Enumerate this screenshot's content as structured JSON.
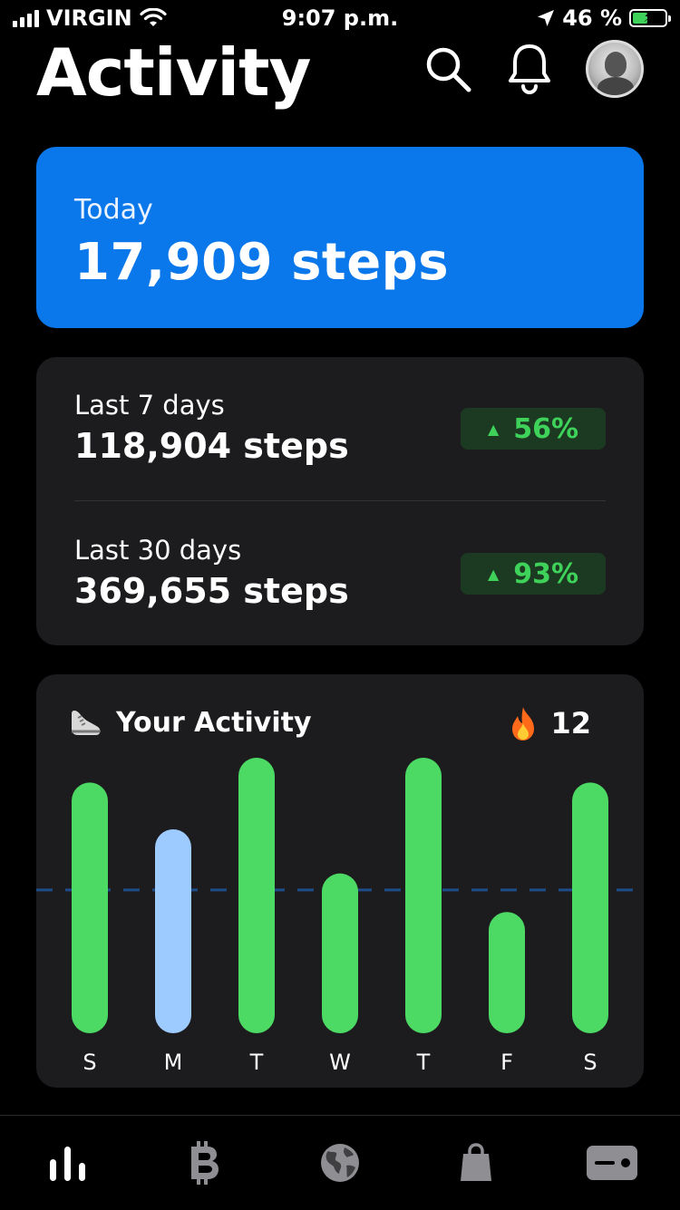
{
  "status_bar": {
    "carrier": "VIRGIN",
    "time": "9:07 p.m.",
    "battery_percent": "46 %",
    "battery_level": 0.46
  },
  "header": {
    "title": "Activity",
    "actions": [
      "search-icon",
      "bell-icon",
      "avatar"
    ]
  },
  "today": {
    "label": "Today",
    "value": "17,909 steps"
  },
  "summary": [
    {
      "label": "Last 7 days",
      "value": "118,904 steps",
      "change": "56%"
    },
    {
      "label": "Last 30 days",
      "value": "369,655 steps",
      "change": "93%"
    }
  ],
  "activity": {
    "title": "Your Activity",
    "title_icon": "sneaker-icon",
    "streak_icon": "fire-icon",
    "streak_count": "12"
  },
  "chart_data": {
    "type": "bar",
    "categories": [
      "S",
      "M",
      "T",
      "W",
      "T",
      "F",
      "S"
    ],
    "values": [
      0.91,
      0.74,
      1.0,
      0.58,
      1.0,
      0.44,
      0.91
    ],
    "highlight_index": 1,
    "goal_line": 0.52,
    "colors": {
      "bar": "#4cd964",
      "highlight": "#9ecbff",
      "goal_line": "#1e4b8a"
    }
  },
  "tabs": [
    {
      "name": "tab-activity",
      "icon": "bar-chart-icon",
      "active": true
    },
    {
      "name": "tab-crypto",
      "icon": "bitcoin-icon",
      "active": false
    },
    {
      "name": "tab-explore",
      "icon": "globe-icon",
      "active": false
    },
    {
      "name": "tab-shop",
      "icon": "shopping-bag-icon",
      "active": false
    },
    {
      "name": "tab-card",
      "icon": "card-icon",
      "active": false
    }
  ],
  "colors": {
    "accent": "#0a77ea",
    "card": "#1c1c1e",
    "positive": "#3fd25a"
  }
}
